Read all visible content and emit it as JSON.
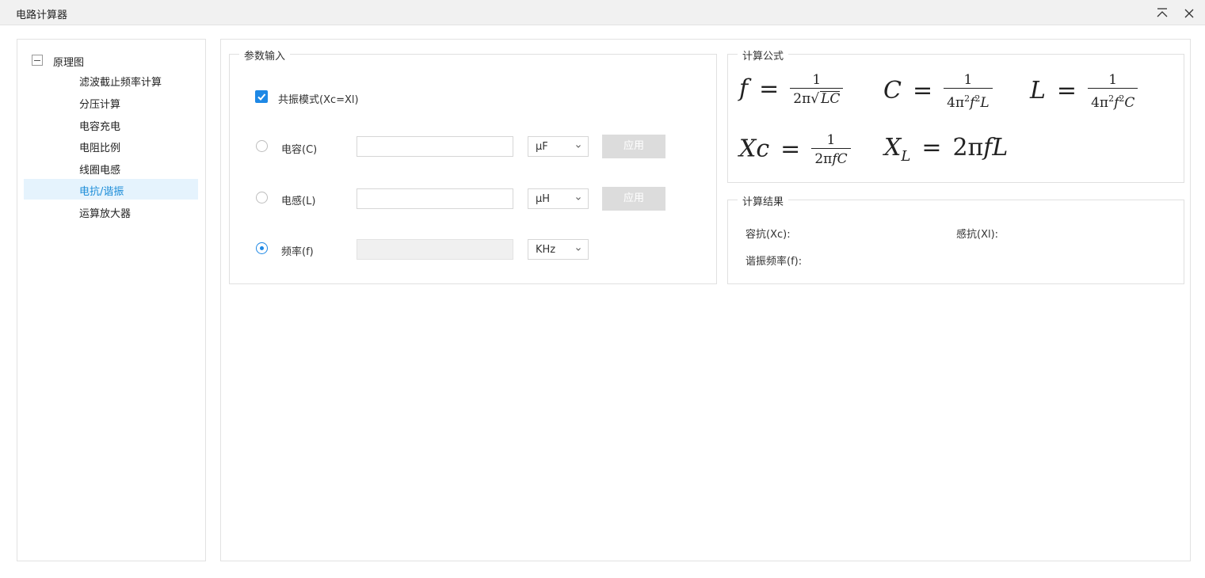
{
  "window": {
    "title": "电路计算器"
  },
  "tree": {
    "root_label": "原理图",
    "items": [
      {
        "label": "滤波截止频率计算"
      },
      {
        "label": "分压计算"
      },
      {
        "label": "电容充电"
      },
      {
        "label": "电阻比例"
      },
      {
        "label": "线圈电感"
      },
      {
        "label": "电抗/谐振"
      },
      {
        "label": "运算放大器"
      }
    ],
    "selected": "电抗/谐振"
  },
  "params": {
    "title": "参数输入",
    "resonance_checkbox": {
      "label": "共振模式(Xc=Xl)",
      "checked": true
    },
    "rows": [
      {
        "label": "电容(C)",
        "value": "",
        "unit": "μF",
        "apply_label": "应用",
        "selected": false
      },
      {
        "label": "电感(L)",
        "value": "",
        "unit": "μH",
        "apply_label": "应用",
        "selected": false
      },
      {
        "label": "频率(f)",
        "value": "",
        "unit": "KHz",
        "selected": true
      }
    ]
  },
  "formulas": {
    "title": "计算公式",
    "f": {
      "lhs": "f",
      "eq": "=",
      "num": "1",
      "den_pre": "2π",
      "den_sqrt": "LC"
    },
    "C": {
      "lhs": "C",
      "eq": "=",
      "num": "1",
      "den_a": "4π",
      "den_sup1": "2",
      "den_b": "f",
      "den_sup2": "2",
      "den_c": "L"
    },
    "L": {
      "lhs": "L",
      "eq": "=",
      "num": "1",
      "den_a": "4π",
      "den_sup1": "2",
      "den_b": "f",
      "den_sup2": "2",
      "den_c": "C"
    },
    "Xc": {
      "lhs": "Xc",
      "eq": "=",
      "num": "1",
      "den_a": "2π",
      "den_b": "fC"
    },
    "XL": {
      "lhs": "X",
      "lhs_sub": "L",
      "eq": "=",
      "rhs_a": "2π",
      "rhs_b": "fL"
    }
  },
  "results": {
    "title": "计算结果",
    "xc_label": "容抗(Xc):",
    "xl_label": "感抗(Xl):",
    "f_label": "谐振频率(f):"
  },
  "colors": {
    "accent": "#1e88e5",
    "selected_bg": "#e5f3fd",
    "selected_text": "#1a8cd8",
    "button_disabled": "#dcdcdc"
  },
  "icons": {
    "collapse": "collapse-up-icon",
    "close": "close-icon",
    "dropdown": "chevron-down-icon",
    "expander": "minus-box-icon"
  }
}
